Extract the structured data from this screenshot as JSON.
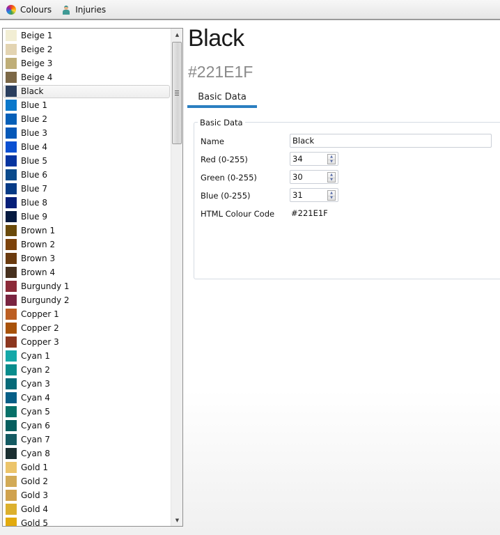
{
  "toolbar": {
    "items": [
      {
        "label": "Colours",
        "icon": "color-wheel-icon"
      },
      {
        "label": "Injuries",
        "icon": "person-icon"
      }
    ]
  },
  "colour_list": {
    "selected": "Black",
    "items": [
      {
        "label": "Beige 1",
        "color": "#F2EED4"
      },
      {
        "label": "Beige 2",
        "color": "#E3D4B2"
      },
      {
        "label": "Beige 3",
        "color": "#BFAE78"
      },
      {
        "label": "Beige 4",
        "color": "#7C6846"
      },
      {
        "label": "Black",
        "color": "#2A3E5E"
      },
      {
        "label": "Blue 1",
        "color": "#0A78CB"
      },
      {
        "label": "Blue 2",
        "color": "#055FB8"
      },
      {
        "label": "Blue 3",
        "color": "#0558B8"
      },
      {
        "label": "Blue 4",
        "color": "#0A50D2"
      },
      {
        "label": "Blue 5",
        "color": "#0534A0"
      },
      {
        "label": "Blue 6",
        "color": "#0A4A8C"
      },
      {
        "label": "Blue 7",
        "color": "#053A86"
      },
      {
        "label": "Blue 8",
        "color": "#051E78"
      },
      {
        "label": "Blue 9",
        "color": "#051A40"
      },
      {
        "label": "Brown 1",
        "color": "#6A4A0A"
      },
      {
        "label": "Brown 2",
        "color": "#7C420A"
      },
      {
        "label": "Brown 3",
        "color": "#6A3A0E"
      },
      {
        "label": "Brown 4",
        "color": "#46301E"
      },
      {
        "label": "Burgundy 1",
        "color": "#8C2A38"
      },
      {
        "label": "Burgundy 2",
        "color": "#7A2440"
      },
      {
        "label": "Copper 1",
        "color": "#BC5E22"
      },
      {
        "label": "Copper 2",
        "color": "#A8520A"
      },
      {
        "label": "Copper 3",
        "color": "#8C361E"
      },
      {
        "label": "Cyan 1",
        "color": "#14A8A8"
      },
      {
        "label": "Cyan 2",
        "color": "#088C8C"
      },
      {
        "label": "Cyan 3",
        "color": "#066A78"
      },
      {
        "label": "Cyan 4",
        "color": "#065E86"
      },
      {
        "label": "Cyan 5",
        "color": "#067068"
      },
      {
        "label": "Cyan 6",
        "color": "#065E5E"
      },
      {
        "label": "Cyan 7",
        "color": "#145A62"
      },
      {
        "label": "Cyan 8",
        "color": "#1A2E30"
      },
      {
        "label": "Gold 1",
        "color": "#ECC46A"
      },
      {
        "label": "Gold 2",
        "color": "#D2AA56"
      },
      {
        "label": "Gold 3",
        "color": "#D0A24E"
      },
      {
        "label": "Gold 4",
        "color": "#DCB02E"
      },
      {
        "label": "Gold 5",
        "color": "#E2AA0E"
      }
    ]
  },
  "detail": {
    "title": "Black",
    "code": "#221E1F",
    "tabs": [
      {
        "label": "Basic Data",
        "active": true
      }
    ],
    "group_title": "Basic Data",
    "fields": {
      "name_label": "Name",
      "name_value": "Black",
      "red_label": "Red (0-255)",
      "red_value": "34",
      "green_label": "Green (0-255)",
      "green_value": "30",
      "blue_label": "Blue (0-255)",
      "blue_value": "31",
      "html_label": "HTML Colour Code",
      "html_value": "#221E1F"
    }
  },
  "accent_color": "#2B7FC0"
}
